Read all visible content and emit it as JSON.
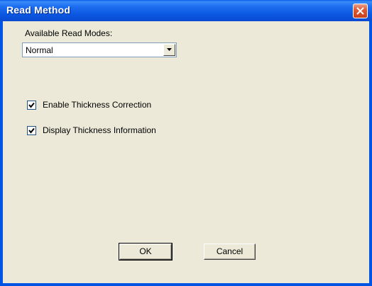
{
  "window": {
    "title": "Read Method"
  },
  "read_modes": {
    "label": "Available Read Modes:",
    "selected": "Normal"
  },
  "options": {
    "thickness_correction": {
      "label": "Enable Thickness Correction",
      "checked": true
    },
    "thickness_information": {
      "label": "Display Thickness Information",
      "checked": true
    }
  },
  "buttons": {
    "ok_label": "OK",
    "cancel_label": "Cancel"
  },
  "icons": {
    "close": "close-icon",
    "dropdown": "chevron-down-icon",
    "check": "checkmark-icon"
  },
  "colors": {
    "titlebar": "#0a56e0",
    "client_background": "#ece9d8",
    "close_button": "#e05a36"
  }
}
